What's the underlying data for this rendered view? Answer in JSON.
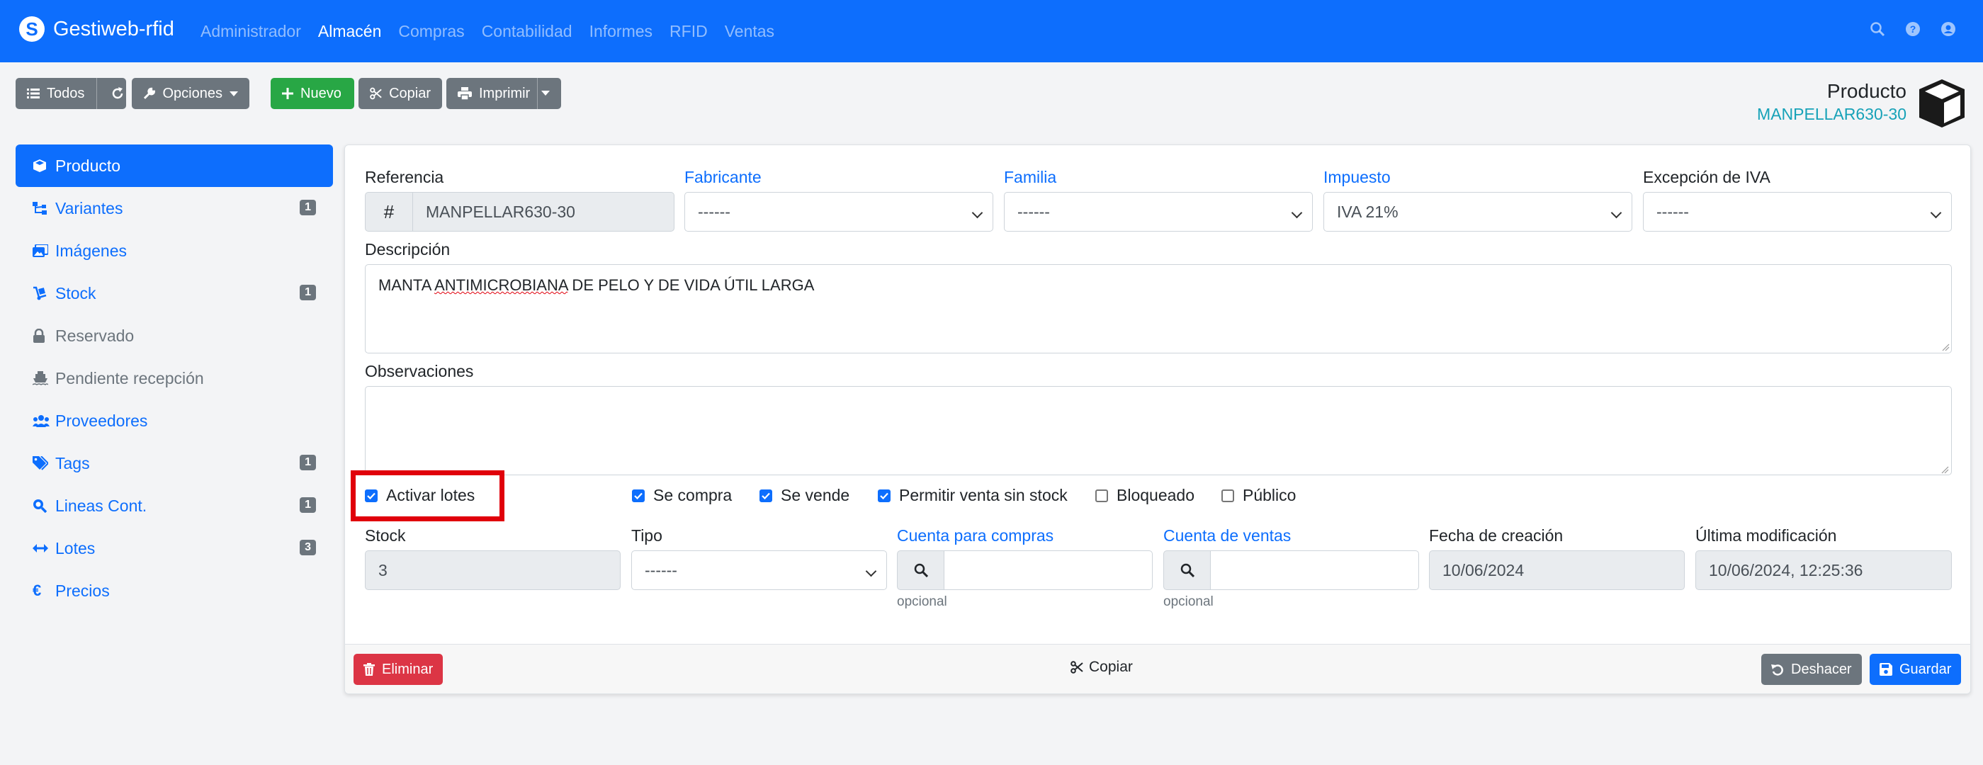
{
  "navbar": {
    "brand_letter": "S",
    "brand": "Gestiweb-rfid",
    "menu": [
      "Administrador",
      "Almacén",
      "Compras",
      "Contabilidad",
      "Informes",
      "RFID",
      "Ventas"
    ],
    "active_menu": "Almacén",
    "icons": [
      "search-icon",
      "help-icon",
      "user-icon"
    ]
  },
  "toolbar": {
    "todos": "Todos",
    "opciones": "Opciones",
    "nuevo": "Nuevo",
    "copiar": "Copiar",
    "imprimir": "Imprimir"
  },
  "header": {
    "title": "Producto",
    "reference": "MANPELLAR630-30"
  },
  "sidebar": {
    "items": [
      {
        "label": "Producto",
        "icon": "box-icon",
        "badge": null,
        "active": true
      },
      {
        "label": "Variantes",
        "icon": "sitemap-icon",
        "badge": "1"
      },
      {
        "label": "Imágenes",
        "icon": "images-icon",
        "badge": null
      },
      {
        "label": "Stock",
        "icon": "dolly-icon",
        "badge": "1"
      },
      {
        "label": "Reservado",
        "icon": "lock-icon",
        "badge": null,
        "muted": true
      },
      {
        "label": "Pendiente recepción",
        "icon": "ship-icon",
        "badge": null,
        "muted": true
      },
      {
        "label": "Proveedores",
        "icon": "users-icon",
        "badge": null
      },
      {
        "label": "Tags",
        "icon": "tags-icon",
        "badge": "1"
      },
      {
        "label": "Lineas Cont.",
        "icon": "search-plus-icon",
        "badge": "1"
      },
      {
        "label": "Lotes",
        "icon": "arrows-h-icon",
        "badge": "3"
      },
      {
        "label": "Precios",
        "icon": "euro-icon",
        "badge": null
      }
    ]
  },
  "form": {
    "referencia": {
      "label": "Referencia",
      "addon": "#",
      "value": "MANPELLAR630-30"
    },
    "fabricante": {
      "label": "Fabricante",
      "value": "------"
    },
    "familia": {
      "label": "Familia",
      "value": "------"
    },
    "impuesto": {
      "label": "Impuesto",
      "value": "IVA 21%"
    },
    "excepcion": {
      "label": "Excepción de IVA",
      "value": "------"
    },
    "descripcion": {
      "label": "Descripción",
      "value_pre": "MANTA ",
      "value_err": "ANTIMICROBIANA",
      "value_post": " DE PELO Y DE VIDA ÚTIL LARGA"
    },
    "observaciones": {
      "label": "Observaciones",
      "value": ""
    },
    "checkboxes": {
      "activar_lotes": {
        "label": "Activar lotes",
        "checked": true
      },
      "se_compra": {
        "label": "Se compra",
        "checked": true
      },
      "se_vende": {
        "label": "Se vende",
        "checked": true
      },
      "permitir": {
        "label": "Permitir venta sin stock",
        "checked": true
      },
      "bloqueado": {
        "label": "Bloqueado",
        "checked": false
      },
      "publico": {
        "label": "Público",
        "checked": false
      }
    },
    "stock": {
      "label": "Stock",
      "value": "3"
    },
    "tipo": {
      "label": "Tipo",
      "value": "------"
    },
    "cuenta_compras": {
      "label": "Cuenta para compras",
      "value": "",
      "help": "opcional"
    },
    "cuenta_ventas": {
      "label": "Cuenta de ventas",
      "value": "",
      "help": "opcional"
    },
    "fecha_creacion": {
      "label": "Fecha de creación",
      "value": "10/06/2024"
    },
    "ultima_mod": {
      "label": "Última modificación",
      "value": "10/06/2024, 12:25:36"
    }
  },
  "footer": {
    "eliminar": "Eliminar",
    "copiar": "Copiar",
    "deshacer": "Deshacer",
    "guardar": "Guardar"
  },
  "colors": {
    "primary": "#0d6efd",
    "secondary": "#6c757d",
    "success": "#28a745",
    "danger": "#dc3545",
    "info": "#17a2b8",
    "highlight": "#e0000b"
  }
}
